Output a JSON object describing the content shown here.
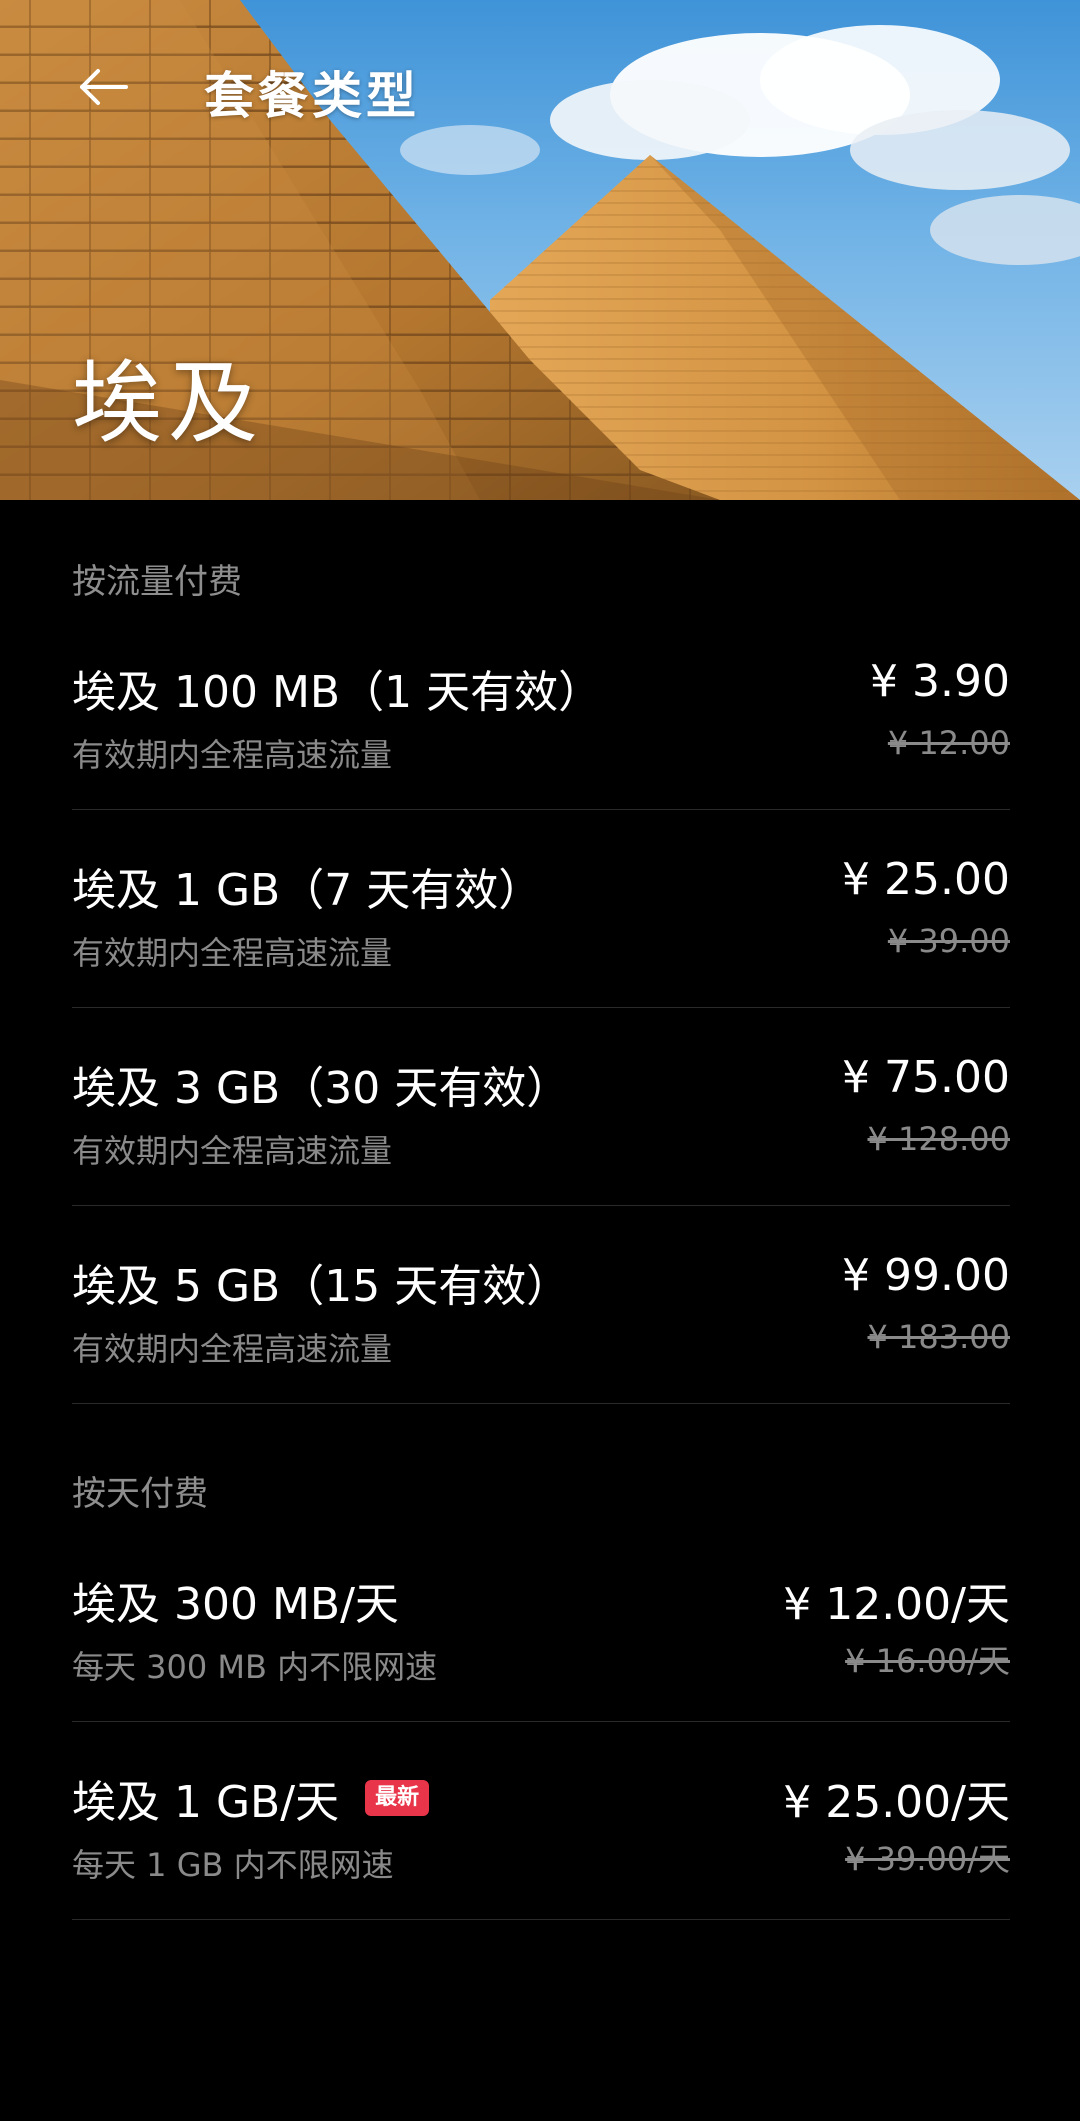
{
  "header": {
    "title": "套餐类型",
    "back_icon": "arrow-left-icon"
  },
  "hero": {
    "country": "埃及"
  },
  "sections": [
    {
      "title": "按流量付费",
      "plans": [
        {
          "name": "埃及 100 MB（1 天有效）",
          "desc": "有效期内全程高速流量",
          "price": "¥ 3.90",
          "old_price": "¥ 12.00"
        },
        {
          "name": "埃及 1 GB（7 天有效）",
          "desc": "有效期内全程高速流量",
          "price": "¥ 25.00",
          "old_price": "¥ 39.00"
        },
        {
          "name": "埃及 3 GB（30 天有效）",
          "desc": "有效期内全程高速流量",
          "price": "¥ 75.00",
          "old_price": "¥ 128.00"
        },
        {
          "name": "埃及 5 GB（15 天有效）",
          "desc": "有效期内全程高速流量",
          "price": "¥ 99.00",
          "old_price": "¥ 183.00"
        }
      ]
    },
    {
      "title": "按天付费",
      "plans": [
        {
          "name": "埃及 300 MB/天",
          "desc": "每天 300 MB 内不限网速",
          "price": "¥ 12.00/天",
          "old_price": "¥ 16.00/天"
        },
        {
          "name": "埃及 1 GB/天",
          "badge": "最新",
          "desc": "每天 1 GB 内不限网速",
          "price": "¥ 25.00/天",
          "old_price": "¥ 39.00/天"
        }
      ]
    }
  ],
  "colors": {
    "background": "#000000",
    "text_primary": "#ffffff",
    "text_secondary": "#8a8a8a",
    "divider": "#2a2a2a",
    "badge": "#e8354a"
  }
}
